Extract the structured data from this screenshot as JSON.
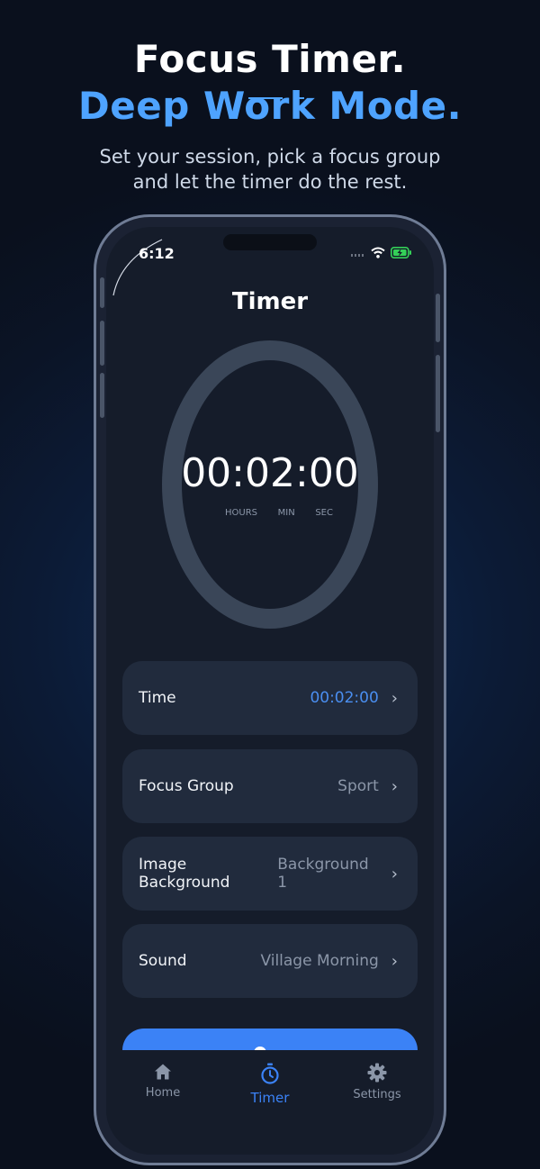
{
  "hero": {
    "title": "Focus Timer.",
    "accent": "Deep Work Mode.",
    "subtitle_line1": "Set your session, pick a focus group",
    "subtitle_line2": "and let the timer do the rest."
  },
  "status_bar": {
    "time": "6:12",
    "icons": [
      "signal-icon",
      "wifi-icon",
      "battery-charging-icon"
    ]
  },
  "screen": {
    "title": "Timer"
  },
  "timer": {
    "display": "00:02:00",
    "units": {
      "hours": "HOURS",
      "min": "MIN",
      "sec": "SEC"
    }
  },
  "settings": [
    {
      "label": "Time",
      "value": "00:02:00"
    },
    {
      "label": "Focus Group",
      "value": "Sport"
    },
    {
      "label": "Image Background",
      "value": "Background 1"
    },
    {
      "label": "Sound",
      "value": "Village Morning"
    }
  ],
  "tabs": [
    {
      "label": "Home",
      "icon": "home-icon"
    },
    {
      "label": "Timer",
      "icon": "stopwatch-icon",
      "active": true
    },
    {
      "label": "Settings",
      "icon": "gear-icon"
    }
  ],
  "colors": {
    "accent": "#4ea3ff",
    "primary_button": "#3b82f6",
    "ring": "#3a4658",
    "row_bg": "#212b3d"
  }
}
